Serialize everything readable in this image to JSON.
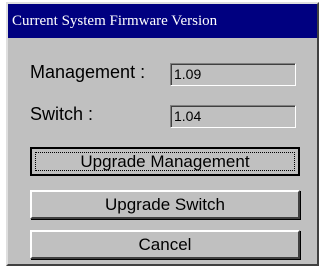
{
  "dialog": {
    "title": "Current System Firmware Version"
  },
  "fields": {
    "management": {
      "label": "Management :",
      "value": "1.09"
    },
    "switch": {
      "label": "Switch :",
      "value": "1.04"
    }
  },
  "buttons": {
    "upgrade_management": "Upgrade Management",
    "upgrade_switch": "Upgrade Switch",
    "cancel": "Cancel"
  },
  "colors": {
    "title_bar": "#000080",
    "dialog_face": "#c0c0c0"
  }
}
